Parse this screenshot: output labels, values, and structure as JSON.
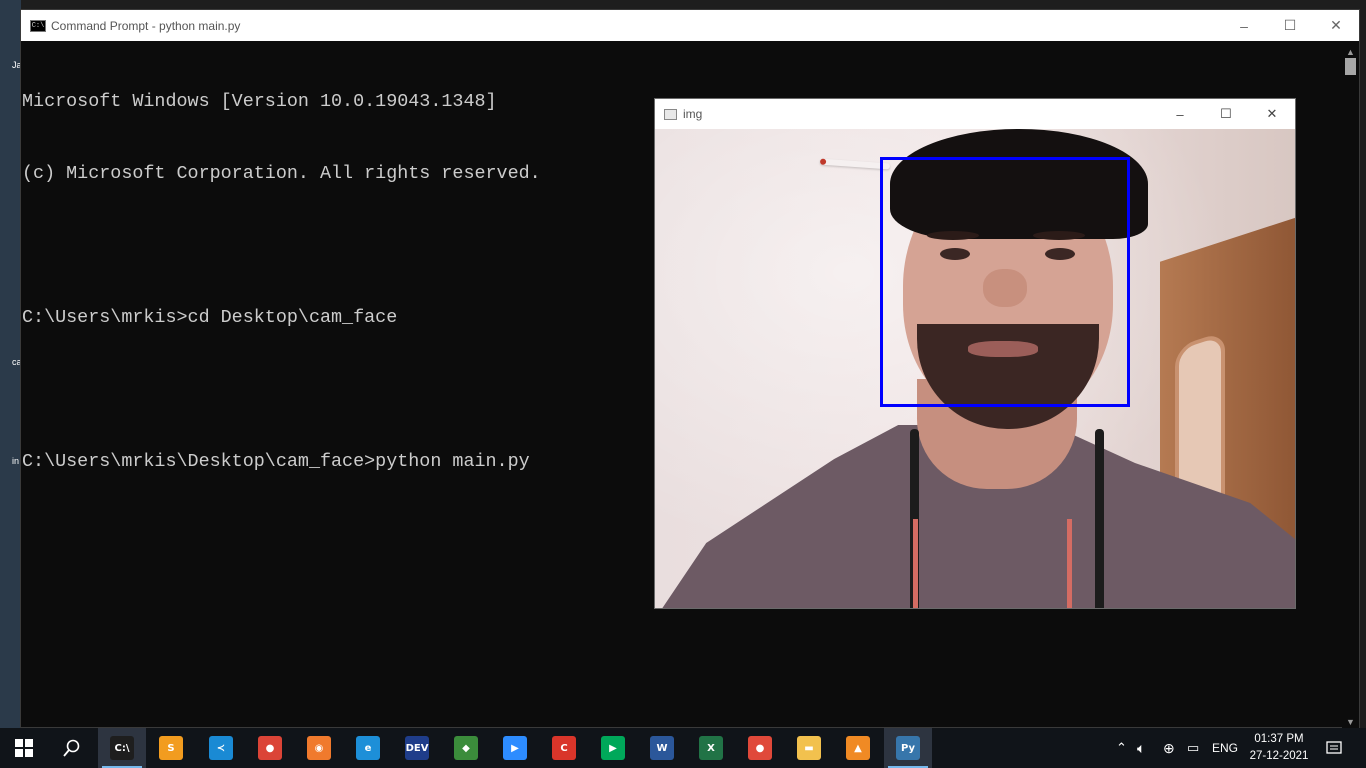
{
  "cmd_window": {
    "title": "Command Prompt - python  main.py",
    "lines": [
      "Microsoft Windows [Version 10.0.19043.1348]",
      "(c) Microsoft Corporation. All rights reserved.",
      "",
      "C:\\Users\\mrkis>cd Desktop\\cam_face",
      "",
      "C:\\Users\\mrkis\\Desktop\\cam_face>python main.py"
    ],
    "controls": {
      "minimize": "–",
      "maximize": "☐",
      "close": "✕"
    }
  },
  "img_window": {
    "title": "img",
    "controls": {
      "minimize": "–",
      "maximize": "☐",
      "close": "✕"
    },
    "detection_box_color": "#0000ff"
  },
  "desktop_labels": [
    "Ja",
    "ca",
    "in"
  ],
  "taskbar": {
    "start_icon": "windows-start-icon",
    "search_icon": "search-icon",
    "apps": [
      {
        "name": "command-prompt-icon",
        "glyph": "C:\\",
        "color": "#1e1e1e",
        "active": true
      },
      {
        "name": "sublime-text-icon",
        "glyph": "S",
        "color": "#f29c1f",
        "active": false
      },
      {
        "name": "vscode-icon",
        "glyph": "≺",
        "color": "#1a8ad4",
        "active": false
      },
      {
        "name": "chrome-icon",
        "glyph": "●",
        "color": "#db4437",
        "active": false
      },
      {
        "name": "ppt-orange-icon",
        "glyph": "◉",
        "color": "#f07a2d",
        "active": false
      },
      {
        "name": "edge-icon",
        "glyph": "e",
        "color": "#1d8fd8",
        "active": false
      },
      {
        "name": "devc-icon",
        "glyph": "DEV",
        "color": "#1f3d8a",
        "active": false
      },
      {
        "name": "git-icon",
        "glyph": "◆",
        "color": "#3b8c3b",
        "active": false
      },
      {
        "name": "zoom-icon",
        "glyph": "▶",
        "color": "#2d8cff",
        "active": false
      },
      {
        "name": "ccleaner-icon",
        "glyph": "C",
        "color": "#d9352a",
        "active": false
      },
      {
        "name": "meet-icon",
        "glyph": "▶",
        "color": "#00a85a",
        "active": false
      },
      {
        "name": "word-icon",
        "glyph": "W",
        "color": "#2b579a",
        "active": false
      },
      {
        "name": "excel-icon",
        "glyph": "X",
        "color": "#217346",
        "active": false
      },
      {
        "name": "screen-recorder-icon",
        "glyph": "●",
        "color": "#e0493a",
        "active": false
      },
      {
        "name": "file-explorer-icon",
        "glyph": "▬",
        "color": "#f2c14e",
        "active": false
      },
      {
        "name": "vlc-icon",
        "glyph": "▲",
        "color": "#f08a24",
        "active": false
      },
      {
        "name": "python-icon",
        "glyph": "Py",
        "color": "#3776ab",
        "active": true
      }
    ],
    "tray": {
      "language": "ENG",
      "time": "01:37 PM",
      "date": "27-12-2021"
    }
  }
}
